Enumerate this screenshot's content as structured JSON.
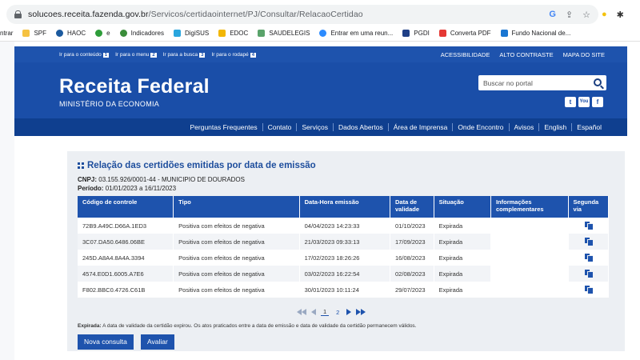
{
  "browser": {
    "url_domain": "solucoes.receita.fazenda.gov.br",
    "url_path": "/Servicos/certidaointernet/PJ/Consultar/RelacaoCertidao",
    "bookmarks": [
      "ntrar",
      "SPF",
      "HAOC",
      "e",
      "Indicadores",
      "DigiSUS",
      "EDOC",
      "SAUDELEGIS",
      "Entrar em uma reun...",
      "PGDI",
      "Converta PDF",
      "Fundo Nacional de..."
    ]
  },
  "govbar": {
    "links": [
      {
        "label": "Ir para o conteúdo",
        "num": "1"
      },
      {
        "label": "Ir para o menu",
        "num": "2"
      },
      {
        "label": "Ir para a busca",
        "num": "3"
      },
      {
        "label": "Ir para o rodapé",
        "num": "4"
      }
    ],
    "right": [
      "ACESSIBILIDADE",
      "ALTO CONTRASTE",
      "MAPA DO SITE"
    ]
  },
  "header": {
    "title": "Receita Federal",
    "subtitle": "MINISTÉRIO DA ECONOMIA",
    "search_placeholder": "Buscar no portal"
  },
  "menu": [
    "Perguntas Frequentes",
    "Contato",
    "Serviços",
    "Dados Abertos",
    "Área de Imprensa",
    "Onde Encontro",
    "Avisos",
    "English",
    "Español"
  ],
  "content": {
    "title": "Relação das certidões emitidas por data de emissão",
    "cnpj_label": "CNPJ:",
    "cnpj_value": "03.155.926/0001-44 - MUNICIPIO DE DOURADOS",
    "periodo_label": "Período:",
    "periodo_value": "01/01/2023 a 16/11/2023",
    "columns": [
      "Código de controle",
      "Tipo",
      "Data-Hora emissão",
      "Data de validade",
      "Situação",
      "Informações complementares",
      "Segunda via"
    ],
    "rows": [
      {
        "codigo": "72B9.A49C.D66A.1ED3",
        "tipo": "Positiva com efeitos de negativa",
        "emissao": "04/04/2023 14:23:33",
        "validade": "01/10/2023",
        "situacao": "Expirada",
        "info": ""
      },
      {
        "codigo": "3C07.DA50.6486.06BE",
        "tipo": "Positiva com efeitos de negativa",
        "emissao": "21/03/2023 09:33:13",
        "validade": "17/09/2023",
        "situacao": "Expirada",
        "info": ""
      },
      {
        "codigo": "245D.A8A4.8A4A.3394",
        "tipo": "Positiva com efeitos de negativa",
        "emissao": "17/02/2023 18:26:26",
        "validade": "16/08/2023",
        "situacao": "Expirada",
        "info": ""
      },
      {
        "codigo": "4574.E0D1.6005.A7E6",
        "tipo": "Positiva com efeitos de negativa",
        "emissao": "03/02/2023 16:22:54",
        "validade": "02/08/2023",
        "situacao": "Expirada",
        "info": ""
      },
      {
        "codigo": "F802.BBC0.4726.C61B",
        "tipo": "Positiva com efeitos de negativa",
        "emissao": "30/01/2023 10:11:24",
        "validade": "29/07/2023",
        "situacao": "Expirada",
        "info": ""
      }
    ],
    "pages": [
      "1",
      "2"
    ],
    "note_label": "Expirada:",
    "note_text": "A data de validade da certidão expirou. Os atos praticados entre a data de emissão e data de validade da certidão permanecem válidos.",
    "btn_nova": "Nova consulta",
    "btn_avaliar": "Avaliar"
  },
  "colors": {
    "header": "#1a4ea8",
    "accent": "#1e53ad"
  }
}
